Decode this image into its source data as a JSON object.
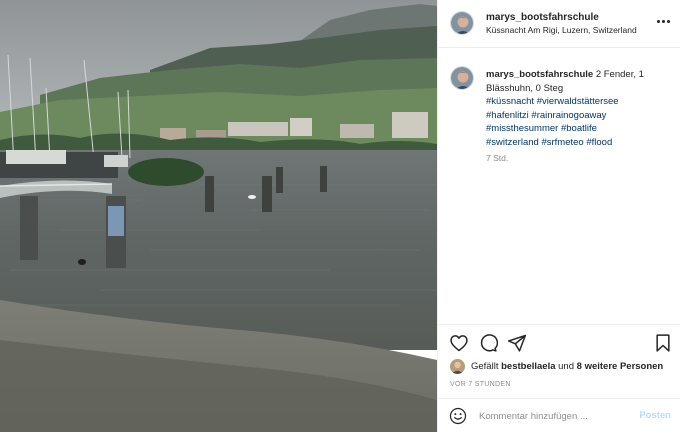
{
  "post": {
    "username": "marys_bootsfahrschule",
    "location": "Küssnacht Am Rigi, Luzern, Switzerland"
  },
  "caption": {
    "username": "marys_bootsfahrschule",
    "text": "2 Fender, 1 Blässhuhn, 0 Steg",
    "hashtags": [
      "#küssnacht",
      "#vierwaldstättersee",
      "#hafenlitzi",
      "#rainrainogoaway",
      "#missthesummer",
      "#boatlife",
      "#switzerland",
      "#srfmeteo",
      "#flood"
    ],
    "time": "7 Std."
  },
  "likes": {
    "prefix": "Gefällt",
    "liker": "bestbellaela",
    "conjunction": "und",
    "others": "8 weitere Personen"
  },
  "timestamp": "VOR 7 STUNDEN",
  "comment": {
    "placeholder": "Kommentar hinzufügen ...",
    "post_label": "Posten"
  },
  "icons": {
    "more": "more-options-icon",
    "like": "heart-icon",
    "comment": "comment-icon",
    "share": "share-icon",
    "save": "bookmark-icon",
    "emoji": "emoji-icon"
  },
  "colors": {
    "text": "#262626",
    "hashtag": "#00376b",
    "muted": "#8e8e8e",
    "post_button": "#b2dffc"
  }
}
